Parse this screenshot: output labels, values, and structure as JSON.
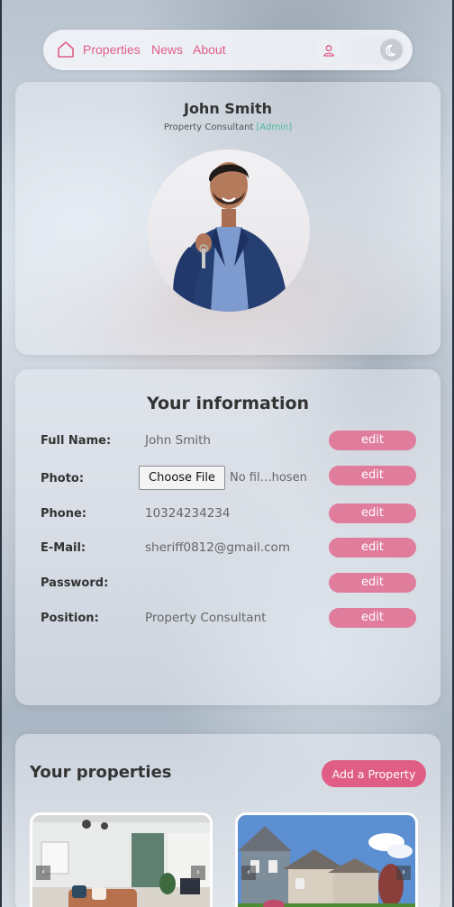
{
  "nav": {
    "links": [
      "Properties",
      "News",
      "About"
    ],
    "home_icon": "home-icon",
    "user_icon": "user-icon",
    "theme_icon": "moon-icon"
  },
  "profile": {
    "name": "John Smith",
    "role": "Property Consultant",
    "badge": "[Admin]"
  },
  "info": {
    "title": "Your information",
    "edit_label": "edit",
    "file_button": "Choose File",
    "file_status": "No fil…hosen",
    "rows": [
      {
        "label": "Full Name:",
        "value": "John Smith"
      },
      {
        "label": "Photo:",
        "value": ""
      },
      {
        "label": "Phone:",
        "value": "10324234234"
      },
      {
        "label": "E-Mail:",
        "value": "sheriff0812@gmail.com"
      },
      {
        "label": "Password:",
        "value": ""
      },
      {
        "label": "Position:",
        "value": "Property Consultant"
      }
    ]
  },
  "properties": {
    "title": "Your properties",
    "add_button": "Add a Property",
    "prev_arrow": "‹",
    "next_arrow": "›"
  },
  "colors": {
    "accent": "#e05d85",
    "edit_button": "#e07d9c",
    "admin_badge": "#4fb89a"
  }
}
